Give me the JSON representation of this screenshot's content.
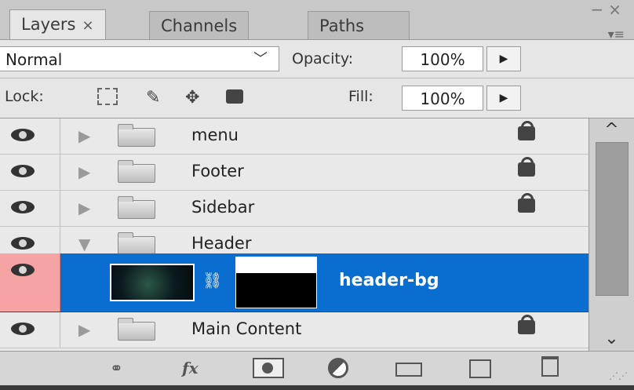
{
  "tabs": [
    {
      "label": "Layers",
      "close": "×"
    },
    {
      "label": "Channels"
    },
    {
      "label": "Paths"
    }
  ],
  "window_controls": {
    "minimize": "−",
    "close": "×",
    "menu": "▾≡"
  },
  "blend_mode": "Normal",
  "opacity": {
    "label": "Opacity:",
    "value": "100%"
  },
  "lock": {
    "label": "Lock:"
  },
  "fill": {
    "label": "Fill:",
    "value": "100%"
  },
  "layers": [
    {
      "name": "menu",
      "type": "group",
      "expanded": false,
      "locked": true
    },
    {
      "name": "Footer",
      "type": "group",
      "expanded": false,
      "locked": true
    },
    {
      "name": "Sidebar",
      "type": "group",
      "expanded": false,
      "locked": true
    },
    {
      "name": "Header",
      "type": "group",
      "expanded": true,
      "locked": false
    },
    {
      "name": "header-bg",
      "type": "layer-with-mask",
      "selected": true
    },
    {
      "name": "Main Content",
      "type": "group",
      "expanded": false,
      "locked": true
    }
  ],
  "icons": {
    "expand_closed": "▶",
    "expand_open": "▼",
    "scroll_up": "^",
    "scroll_down": "⌄",
    "link": "⚭",
    "chain": "⛓",
    "move": "✥",
    "brush": "✎"
  },
  "toolbar": {
    "fx": "fx"
  },
  "colors": {
    "selection": "#0a6ed1",
    "eye_highlight": "#f5a3a3"
  }
}
